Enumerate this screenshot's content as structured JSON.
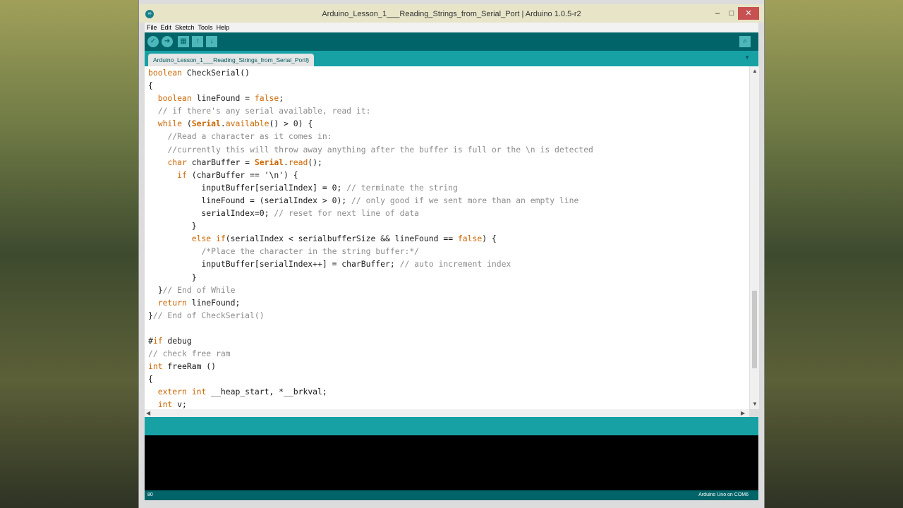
{
  "window": {
    "title": "Arduino_Lesson_1___Reading_Strings_from_Serial_Port | Arduino 1.0.5-r2",
    "minimize": "–",
    "maximize": "□",
    "close": "✕"
  },
  "menu": [
    "File",
    "Edit",
    "Sketch",
    "Tools",
    "Help"
  ],
  "toolbar": {
    "verify_icon": "✓",
    "upload_icon": "➜",
    "new_icon": "▦",
    "open_icon": "↑",
    "save_icon": "↓",
    "serial_monitor_icon": "⌕"
  },
  "tab": {
    "label": "Arduino_Lesson_1___Reading_Strings_from_Serial_Port§",
    "menu_icon": "▼"
  },
  "editor": {
    "code_lines": [
      "boolean CheckSerial()",
      "{",
      "  boolean lineFound = false;",
      "  // if there's any serial available, read it:",
      "  while (Serial.available() > 0) {",
      "    //Read a character as it comes in:",
      "    //currently this will throw away anything after the buffer is full or the \\n is detected",
      "    char charBuffer = Serial.read();",
      "      if (charBuffer == '\\n') {",
      "           inputBuffer[serialIndex] = 0; // terminate the string",
      "           lineFound = (serialIndex > 0); // only good if we sent more than an empty line",
      "           serialIndex=0; // reset for next line of data",
      "         }",
      "         else if(serialIndex < serialbufferSize && lineFound == false) {",
      "           /*Place the character in the string buffer:*/",
      "           inputBuffer[serialIndex++] = charBuffer; // auto increment index",
      "         }",
      "  }// End of While",
      "  return lineFound;",
      "}// End of CheckSerial()",
      "",
      "#if debug",
      "// check free ram",
      "int freeRam ()",
      "{",
      "  extern int __heap_start, *__brkval;",
      "  int v;"
    ]
  },
  "status": {
    "line_number": "80",
    "board": "Arduino Uno on COM6"
  },
  "colors": {
    "toolbar": "#006468",
    "tabbar": "#17a1a5",
    "keyword": "#cc6600",
    "comment": "#8c8c8c"
  }
}
